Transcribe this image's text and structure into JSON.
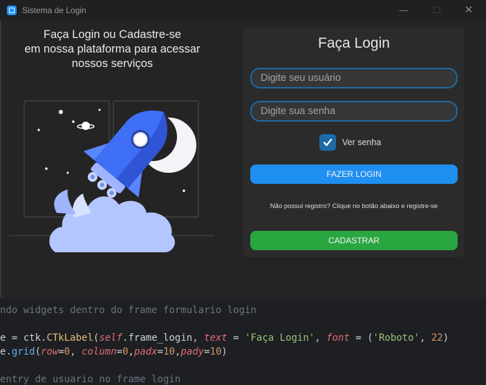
{
  "window": {
    "title": "Sistema de Login",
    "controls": {
      "minimize": "—",
      "maximize": "☐",
      "close": "✕"
    }
  },
  "left_panel": {
    "headline_lines": [
      "Faça Login ou Cadastre-se",
      "em nossa plataforma para acessar",
      "nossos serviços"
    ],
    "illustration": "rocket-launch-illustration"
  },
  "login_form": {
    "title": "Faça Login",
    "username": {
      "placeholder": "Digite seu usuário",
      "value": ""
    },
    "password": {
      "placeholder": "Digite sua senha",
      "value": ""
    },
    "show_password": {
      "label": "Ver senha",
      "checked": true
    },
    "login_button": "FAZER LOGIN",
    "register_note": "Não possui registro? Clique no botão abaixo e registre-se",
    "register_button": "CADASTRAR"
  },
  "colors": {
    "window_bg": "#242424",
    "panel_bg": "#2b2b2b",
    "accent_blue": "#1f8ff0",
    "accent_green": "#2aa641",
    "field_border": "#1f6aa5"
  },
  "code_editor": {
    "line1": "ndo widgets dentro do frame formulario login",
    "line2": [
      {
        "t": "e = ",
        "c": ""
      },
      {
        "t": "ctk",
        "c": ""
      },
      {
        "t": ".",
        "c": ""
      },
      {
        "t": "CTkLabel",
        "c": "fn"
      },
      {
        "t": "(",
        "c": ""
      },
      {
        "t": "self",
        "c": "it"
      },
      {
        "t": ".frame_login, ",
        "c": ""
      },
      {
        "t": "text",
        "c": "it"
      },
      {
        "t": " = ",
        "c": ""
      },
      {
        "t": "'Faça Login'",
        "c": "str"
      },
      {
        "t": ", ",
        "c": ""
      },
      {
        "t": "font",
        "c": "it"
      },
      {
        "t": " = (",
        "c": ""
      },
      {
        "t": "'Roboto'",
        "c": "str"
      },
      {
        "t": ", ",
        "c": ""
      },
      {
        "t": "22",
        "c": "num"
      },
      {
        "t": ")",
        "c": ""
      }
    ],
    "line3": [
      {
        "t": "e",
        "c": ""
      },
      {
        "t": ".",
        "c": ""
      },
      {
        "t": "grid",
        "c": "call"
      },
      {
        "t": "(",
        "c": ""
      },
      {
        "t": "row",
        "c": "it"
      },
      {
        "t": "=",
        "c": ""
      },
      {
        "t": "0",
        "c": "num"
      },
      {
        "t": ", ",
        "c": ""
      },
      {
        "t": "column",
        "c": "it"
      },
      {
        "t": "=",
        "c": ""
      },
      {
        "t": "0",
        "c": "num"
      },
      {
        "t": ",",
        "c": ""
      },
      {
        "t": "padx",
        "c": "it"
      },
      {
        "t": "=",
        "c": ""
      },
      {
        "t": "10",
        "c": "num"
      },
      {
        "t": ",",
        "c": ""
      },
      {
        "t": "pady",
        "c": "it"
      },
      {
        "t": "=",
        "c": ""
      },
      {
        "t": "10",
        "c": "num"
      },
      {
        "t": ")",
        "c": ""
      }
    ],
    "line4": "entry de usuario no frame login"
  }
}
